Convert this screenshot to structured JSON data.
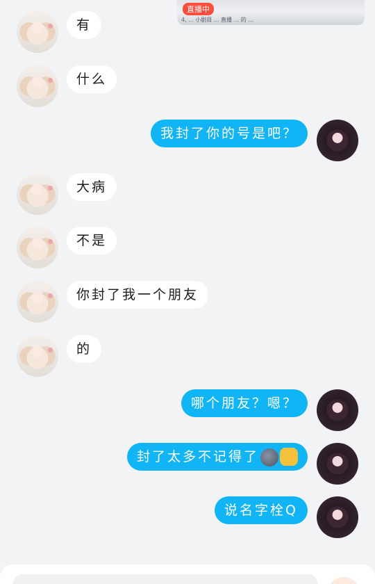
{
  "top_image": {
    "live_badge": "直播中",
    "caption": "4, ... 小剧目 ... 直播 ... 的 ..."
  },
  "messages": [
    {
      "side": "left",
      "text": "有"
    },
    {
      "side": "left",
      "text": "什么"
    },
    {
      "side": "right",
      "text": "我封了你的号是吧？"
    },
    {
      "side": "left",
      "text": "大病"
    },
    {
      "side": "left",
      "text": "不是"
    },
    {
      "side": "left",
      "text": "你封了我一个朋友"
    },
    {
      "side": "left",
      "text": "的"
    },
    {
      "side": "right",
      "text": "哪个朋友？嗯？"
    },
    {
      "side": "right",
      "text": "封了太多不记得了"
    },
    {
      "side": "right",
      "text": "说名字栓Q"
    }
  ],
  "emoji_icons": [
    "new-moon-face",
    "oncoming-fist"
  ],
  "colors": {
    "background": "#f2f3f5",
    "own_bubble": "#11b4f5",
    "other_bubble": "#ffffff"
  },
  "input": {
    "placeholder": ""
  }
}
